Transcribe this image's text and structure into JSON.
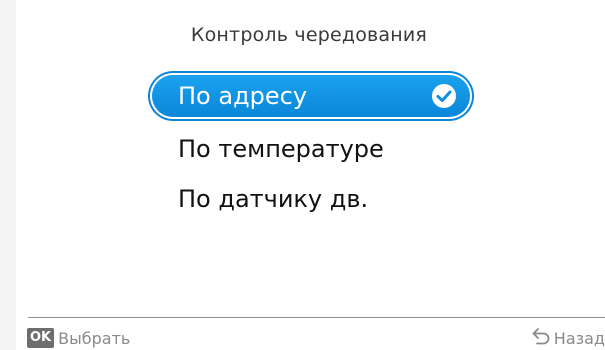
{
  "header": {
    "title": "Контроль чередования"
  },
  "options": [
    {
      "label": "По адресу",
      "selected": true
    },
    {
      "label": "По температуре",
      "selected": false
    },
    {
      "label": "По датчику дв.",
      "selected": false
    }
  ],
  "footer": {
    "ok_badge": "OK",
    "select_label": "Выбрать",
    "back_label": "Назад",
    "back_icon": "return-arrow-icon"
  },
  "colors": {
    "accent": "#0d8fe0",
    "text": "#111111",
    "muted": "#8a8a8a",
    "badge": "#6e6e6e"
  }
}
